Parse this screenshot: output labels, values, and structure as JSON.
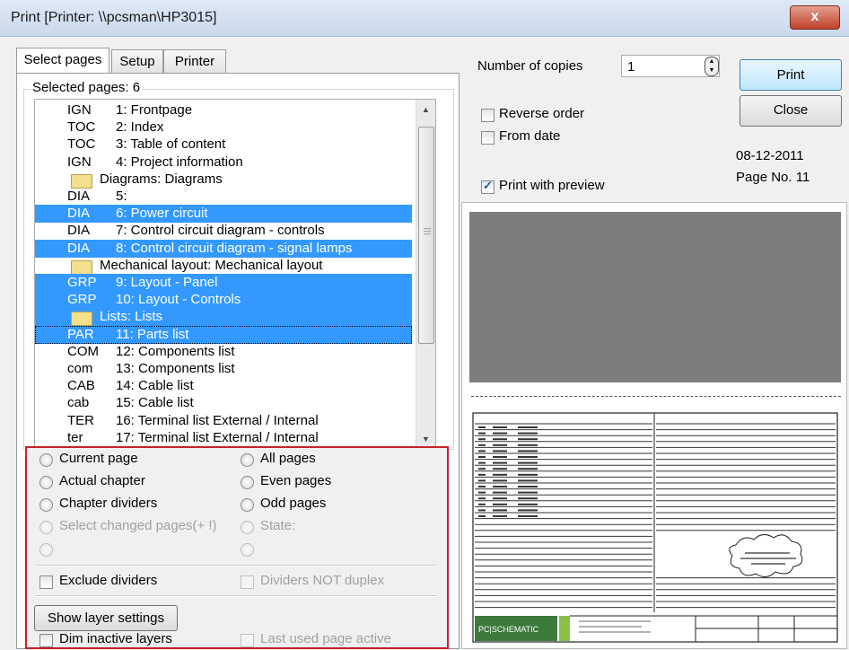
{
  "window": {
    "title": "Print [Printer: \\\\pcsman\\HP3015]",
    "close_glyph": "x"
  },
  "tabs": [
    {
      "label": "Select pages",
      "active": true
    },
    {
      "label": "Setup",
      "active": false
    },
    {
      "label": "Printer",
      "active": false
    }
  ],
  "selected_pages_label": "Selected pages: 6",
  "pages": [
    {
      "type": "page",
      "code": "IGN",
      "desc": "1: Frontpage",
      "selected": false
    },
    {
      "type": "page",
      "code": "TOC",
      "desc": "2: Index",
      "selected": false
    },
    {
      "type": "page",
      "code": "TOC",
      "desc": "3: Table of content",
      "selected": false
    },
    {
      "type": "page",
      "code": "IGN",
      "desc": "4: Project information",
      "selected": false
    },
    {
      "type": "folder",
      "desc": "Diagrams: Diagrams",
      "selected": false
    },
    {
      "type": "page",
      "code": "DIA",
      "desc": "5:",
      "selected": false
    },
    {
      "type": "page",
      "code": "DIA",
      "desc": "6: Power circuit",
      "selected": true
    },
    {
      "type": "page",
      "code": "DIA",
      "desc": "7: Control circuit diagram - controls",
      "selected": false
    },
    {
      "type": "page",
      "code": "DIA",
      "desc": "8: Control circuit diagram - signal lamps",
      "selected": true
    },
    {
      "type": "folder",
      "desc": "Mechanical layout: Mechanical layout",
      "selected": false
    },
    {
      "type": "page",
      "code": "GRP",
      "desc": "9: Layout - Panel",
      "selected": true
    },
    {
      "type": "page",
      "code": "GRP",
      "desc": "10: Layout - Controls",
      "selected": true
    },
    {
      "type": "folder",
      "desc": "Lists: Lists",
      "selected": true
    },
    {
      "type": "page",
      "code": "PAR",
      "desc": "11: Parts list",
      "selected": true,
      "focused": true
    },
    {
      "type": "page",
      "code": "COM",
      "desc": "12: Components list",
      "selected": false
    },
    {
      "type": "page",
      "code": "com",
      "desc": "13: Components list",
      "selected": false
    },
    {
      "type": "page",
      "code": "CAB",
      "desc": "14: Cable list",
      "selected": false
    },
    {
      "type": "page",
      "code": "cab",
      "desc": "15: Cable list",
      "selected": false
    },
    {
      "type": "page",
      "code": "TER",
      "desc": "16: Terminal list External / Internal",
      "selected": false
    },
    {
      "type": "page",
      "code": "ter",
      "desc": "17: Terminal list External / Internal",
      "selected": false
    }
  ],
  "range_options": {
    "current_page": "Current page",
    "actual_chapter": "Actual chapter",
    "chapter_dividers": "Chapter dividers",
    "select_changed": "Select changed pages(+ !)",
    "all_pages": "All pages",
    "even_pages": "Even pages",
    "odd_pages": "Odd pages",
    "state": "State:"
  },
  "exclude_dividers": "Exclude dividers",
  "dividers_not_duplex": "Dividers NOT duplex",
  "show_layer_settings": "Show layer settings",
  "dim_inactive_layers": "Dim inactive layers",
  "last_used_page_active": "Last used page active",
  "copies": {
    "label": "Number of copies",
    "value": "1"
  },
  "reverse_order": "Reverse order",
  "from_date": "From date",
  "print_with_preview": {
    "label": "Print with preview",
    "checked": true
  },
  "date": "08-12-2011",
  "page_no": "Page No. 11",
  "buttons": {
    "print": "Print",
    "close": "Close"
  },
  "preview_logo": "PC|SCHEMATIC",
  "colors": {
    "selection": "#3399ff",
    "highlight_frame": "#c8202a",
    "preview_gray": "#7d7d7d"
  }
}
